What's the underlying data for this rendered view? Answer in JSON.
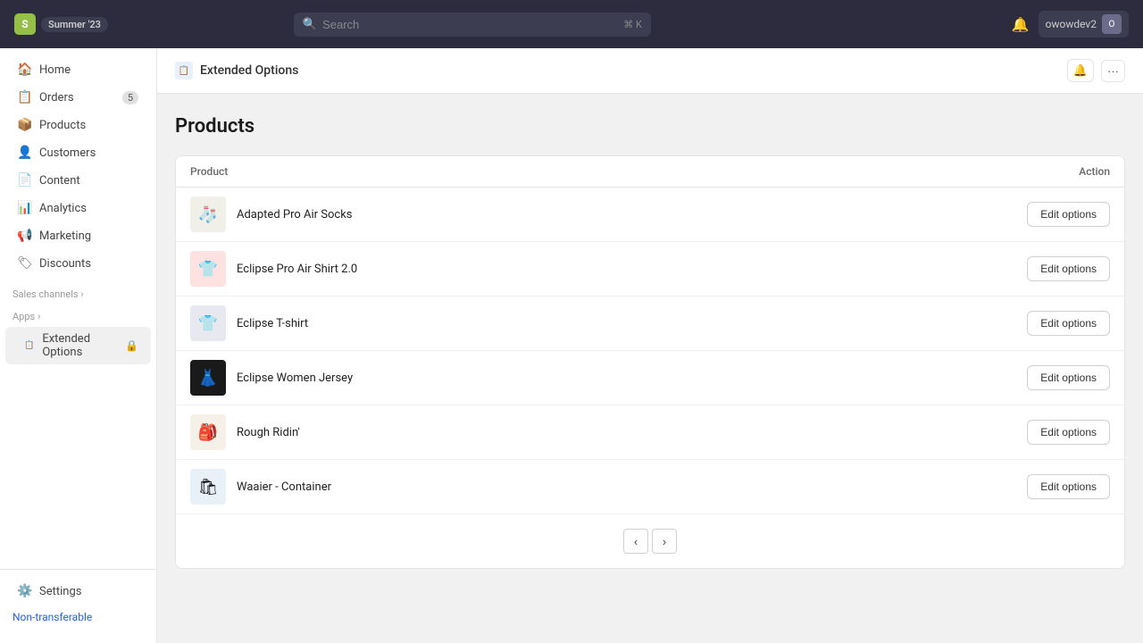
{
  "topbar": {
    "logo_letter": "S",
    "store_name": "Summer '23",
    "search_placeholder": "Search",
    "search_shortcut": "⌘ K",
    "user_name": "owowdev2",
    "user_initial": "O"
  },
  "sidebar": {
    "nav_items": [
      {
        "id": "home",
        "label": "Home",
        "icon": "🏠",
        "badge": null
      },
      {
        "id": "orders",
        "label": "Orders",
        "icon": "📋",
        "badge": "5"
      },
      {
        "id": "products",
        "label": "Products",
        "icon": "📦",
        "badge": null
      },
      {
        "id": "customers",
        "label": "Customers",
        "icon": "👤",
        "badge": null
      },
      {
        "id": "content",
        "label": "Content",
        "icon": "📄",
        "badge": null
      },
      {
        "id": "analytics",
        "label": "Analytics",
        "icon": "📊",
        "badge": null
      },
      {
        "id": "marketing",
        "label": "Marketing",
        "icon": "📢",
        "badge": null
      },
      {
        "id": "discounts",
        "label": "Discounts",
        "icon": "🏷",
        "badge": null
      }
    ],
    "sales_channels_label": "Sales channels",
    "sales_channels_expand": "›",
    "apps_label": "Apps",
    "apps_expand": "›",
    "extended_options_label": "Extended Options",
    "settings_label": "Settings",
    "non_transferable_label": "Non-transferable"
  },
  "app_header": {
    "icon": "📋",
    "title": "Extended Options",
    "bell_label": "🔔",
    "more_label": "···"
  },
  "page": {
    "title": "Products",
    "table": {
      "col_product": "Product",
      "col_action": "Action",
      "rows": [
        {
          "id": 1,
          "name": "Adapted Pro Air Socks",
          "thumb_emoji": "🧦",
          "thumb_class": "thumb-socks",
          "action_label": "Edit options"
        },
        {
          "id": 2,
          "name": "Eclipse Pro Air Shirt 2.0",
          "thumb_emoji": "👕",
          "thumb_class": "thumb-shirt-red",
          "action_label": "Edit options"
        },
        {
          "id": 3,
          "name": "Eclipse T-shirt",
          "thumb_emoji": "👕",
          "thumb_class": "thumb-tshirt",
          "action_label": "Edit options"
        },
        {
          "id": 4,
          "name": "Eclipse Women Jersey",
          "thumb_emoji": "👗",
          "thumb_class": "thumb-jersey",
          "action_label": "Edit options"
        },
        {
          "id": 5,
          "name": "Rough Ridin'",
          "thumb_emoji": "🎒",
          "thumb_class": "thumb-ridin",
          "action_label": "Edit options"
        },
        {
          "id": 6,
          "name": "Waaier - Container",
          "thumb_emoji": "🛍",
          "thumb_class": "thumb-container",
          "action_label": "Edit options"
        }
      ]
    },
    "pagination": {
      "prev_label": "‹",
      "next_label": "›"
    }
  }
}
